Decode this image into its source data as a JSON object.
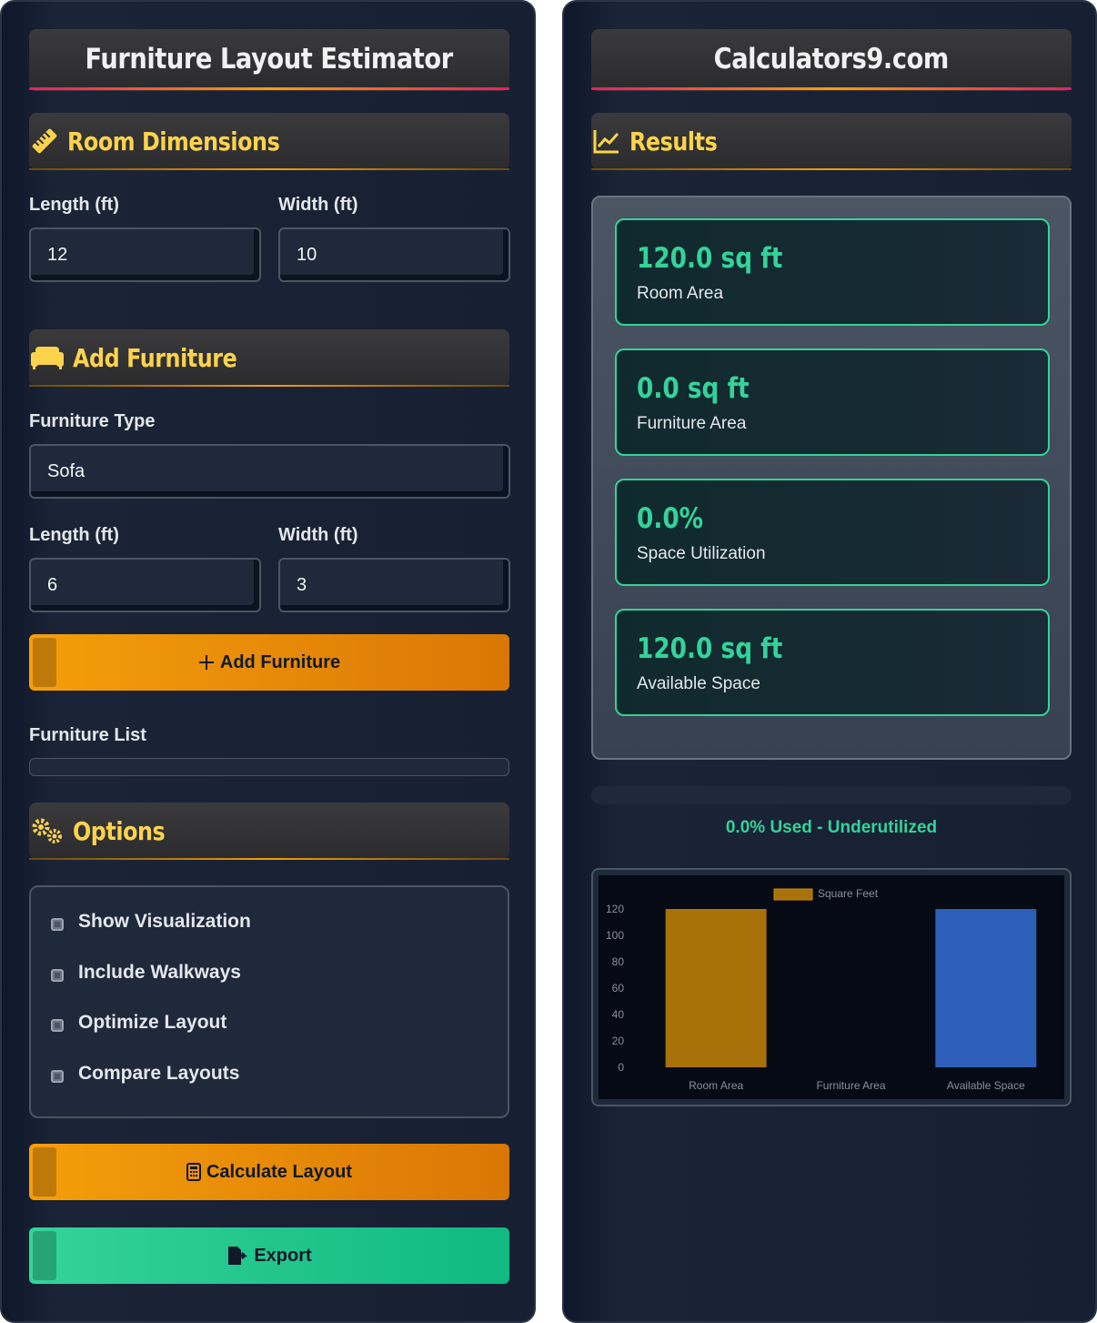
{
  "left": {
    "title": "Furniture Layout Estimator",
    "room_section": "Room Dimensions",
    "room_length_label": "Length (ft)",
    "room_width_label": "Width (ft)",
    "room_length_value": "12",
    "room_width_value": "10",
    "furniture_section": "Add Furniture",
    "furniture_type_label": "Furniture Type",
    "furniture_type_value": "Sofa",
    "furn_length_label": "Length (ft)",
    "furn_width_label": "Width (ft)",
    "furn_length_value": "6",
    "furn_width_value": "3",
    "add_button": "Add Furniture",
    "furniture_list_label": "Furniture List",
    "options_section": "Options",
    "options": [
      "Show Visualization",
      "Include Walkways",
      "Optimize Layout",
      "Compare Layouts"
    ],
    "calculate_button": "Calculate Layout",
    "export_button": "Export"
  },
  "right": {
    "title": "Calculators9.com",
    "results_section": "Results",
    "cards": [
      {
        "value": "120.0 sq ft",
        "label": "Room Area"
      },
      {
        "value": "0.0 sq ft",
        "label": "Furniture Area"
      },
      {
        "value": "0.0%",
        "label": "Space Utilization"
      },
      {
        "value": "120.0 sq ft",
        "label": "Available Space"
      }
    ],
    "utilization_fraction": 0,
    "status": "0.0% Used - Underutilized"
  },
  "colors": {
    "accent_orange": "#f59e0b",
    "accent_green": "#34d399",
    "heading_yellow": "#fcd34d"
  },
  "chart_data": {
    "type": "bar",
    "categories": [
      "Room Area",
      "Furniture Area",
      "Available Space"
    ],
    "series": [
      {
        "name": "Square Feet",
        "values": [
          120,
          0,
          120
        ]
      }
    ],
    "bar_colors": [
      "#a8710a",
      "#a8710a",
      "#2d5fb8"
    ],
    "legend_color": "#a8710a",
    "yticks": [
      0,
      20,
      40,
      60,
      80,
      100,
      120
    ],
    "ylim": [
      0,
      120
    ],
    "legend_position": "top"
  }
}
